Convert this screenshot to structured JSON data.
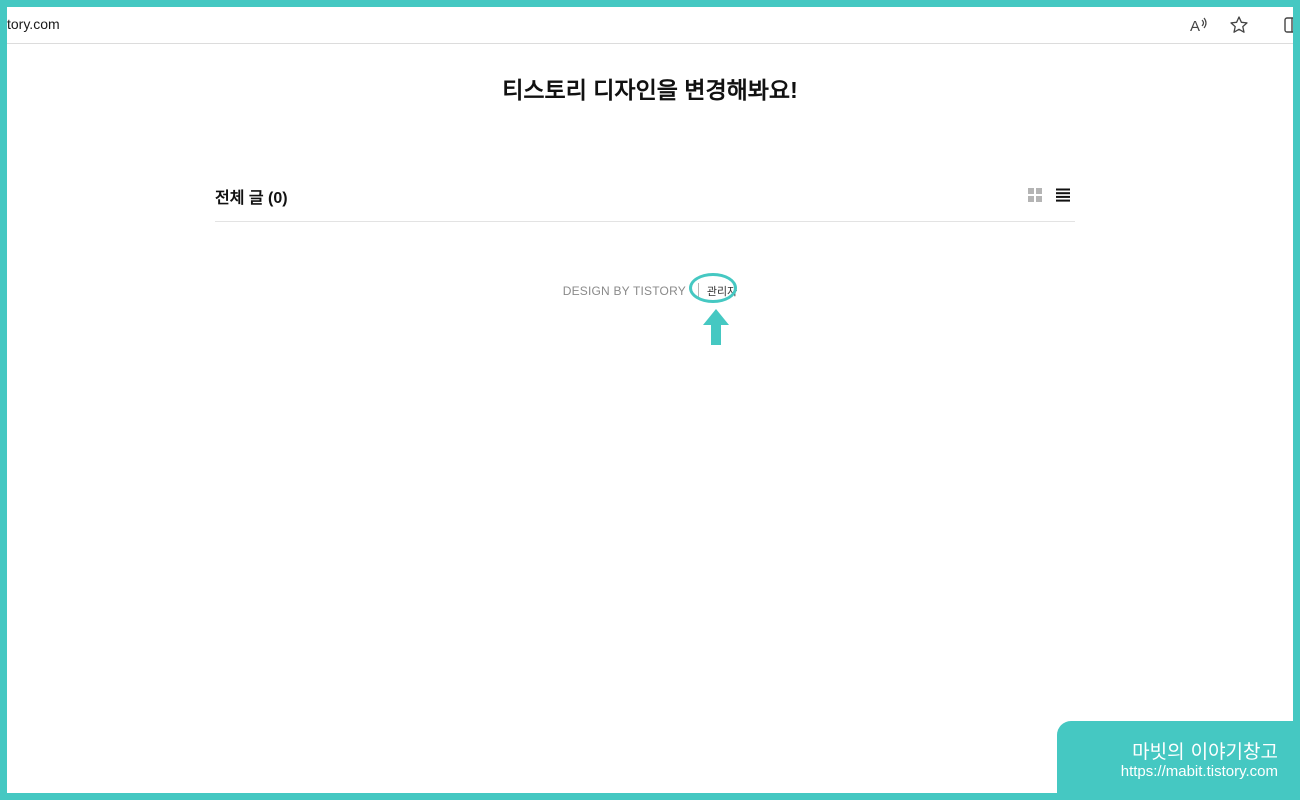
{
  "browser": {
    "url_text": "tory.com",
    "icons": [
      "read-aloud-icon",
      "favorite-star-icon",
      "sidebar-toggle-icon"
    ]
  },
  "page": {
    "title": "티스토리 디자인을 변경해봐요!",
    "section_title": "전체 글 (0)",
    "view_icons": [
      "grid-view-icon",
      "list-view-icon"
    ]
  },
  "footer": {
    "design_by": "DESIGN BY TISTORY",
    "admin_label": "관리자"
  },
  "annotation": {
    "color": "#45c8c2"
  },
  "watermark": {
    "title": "마빗의 이야기창고",
    "url": "https://mabit.tistory.com"
  }
}
